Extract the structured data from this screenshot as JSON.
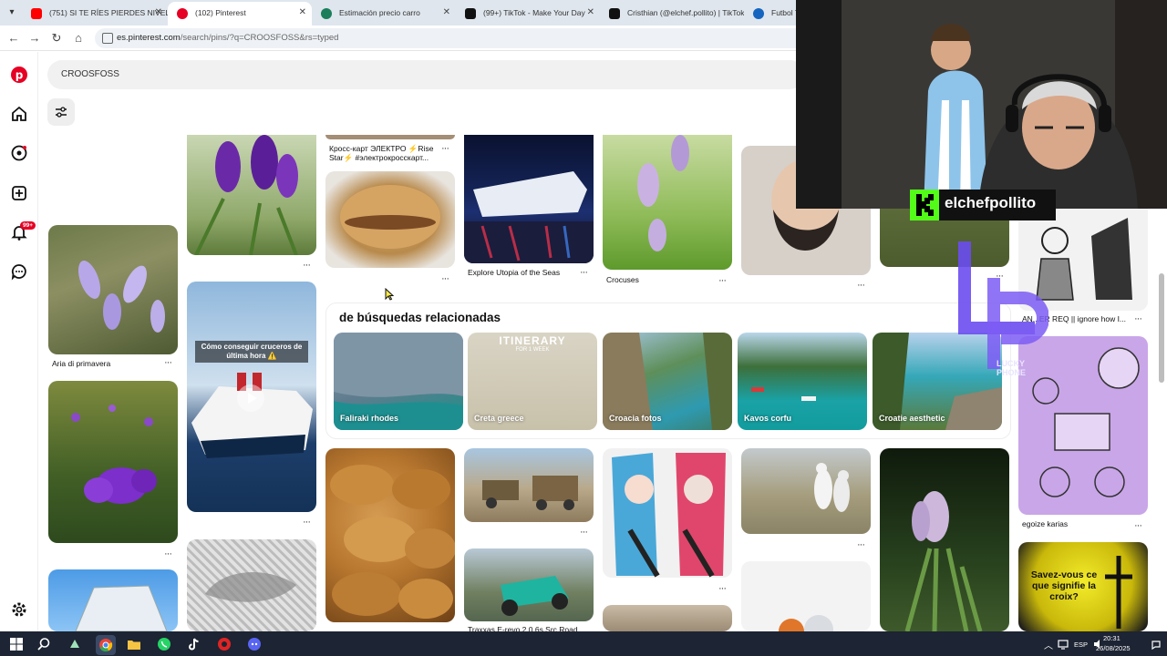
{
  "browser": {
    "tabs": [
      {
        "label": "(751) SI TE RÍES PIERDES NIVEL",
        "favicon_color": "#ff0000"
      },
      {
        "label": "(102) Pinterest",
        "favicon_color": "#e60023"
      },
      {
        "label": "Estimación precio carro",
        "favicon_color": "#1a7f5a"
      },
      {
        "label": "(99+) TikTok - Make Your Day",
        "favicon_color": "#111111"
      },
      {
        "label": "Cristhian (@elchef.pollito) | TikTok",
        "favicon_color": "#111111"
      },
      {
        "label": "Futbol T",
        "favicon_color": "#1565c0"
      }
    ],
    "url_domain": "es.pinterest.com",
    "url_path": "/search/pins/?q=CROOSFOSS&rs=typed"
  },
  "sidebar": {
    "notification_badge": "99+",
    "items": [
      "pinterest-logo",
      "home-icon",
      "explore-icon",
      "create-icon",
      "notifications-icon",
      "messages-icon",
      "settings-icon"
    ]
  },
  "search": {
    "query": "CROOSFOSS"
  },
  "pins": {
    "col1": [
      {
        "title": "Aria di primavera"
      }
    ],
    "col3": [
      {
        "title": "Кросс-карт ЭЛЕКТРО ⚡Rise Star⚡ #электрокросскарт..."
      },
      {
        "title": ""
      }
    ],
    "col4": [
      {
        "title": "Explore Utopia of the Seas"
      },
      {
        "title": "Traxxas E-revo 2.0 6s Src Road"
      }
    ],
    "col5": [
      {
        "title": "Crocuses"
      }
    ],
    "col8": [
      {
        "title": "AN...ER REQ || ignore how I..."
      },
      {
        "title": "egoize karias"
      }
    ],
    "video_overlay": "Cómo conseguir cruceros de última hora ⚠️",
    "itinerary_text": "ITINERARY",
    "itinerary_sub": "FOR 1 WEEK",
    "cross_text": "Savez-vous ce que signifie la croix?"
  },
  "related": {
    "title": "de búsquedas relacionadas",
    "items": [
      {
        "label": "Faliraki rhodes"
      },
      {
        "label": "Creta greece"
      },
      {
        "label": "Croacia fotos"
      },
      {
        "label": "Kavos corfu"
      },
      {
        "label": "Croatie aesthetic"
      }
    ]
  },
  "overlay": {
    "streamer_name": "elchefpollito",
    "watermark": "LUCKY PHONE"
  },
  "taskbar": {
    "language": "ESP",
    "time": "20:31",
    "date": "26/08/2025"
  }
}
